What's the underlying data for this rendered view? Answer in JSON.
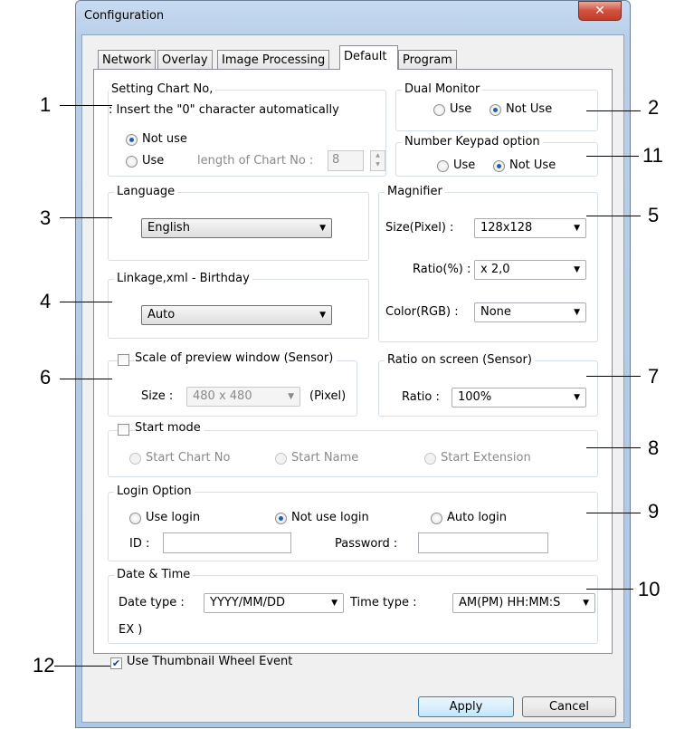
{
  "window": {
    "title": "Configuration",
    "close_label": "x"
  },
  "tabs": [
    "Network",
    "Overlay",
    "Image Processing",
    "Default",
    "Program"
  ],
  "chart_no": {
    "legend": "Setting Chart No,",
    "desc": ": Insert the \"0\" character automatically",
    "opt_not_use": "Not use",
    "opt_use": "Use",
    "length_label": "length of Chart No :",
    "length_value": "8"
  },
  "dual_monitor": {
    "legend": "Dual Monitor",
    "opt_use": "Use",
    "opt_not_use": "Not Use"
  },
  "keypad": {
    "legend": "Number Keypad option",
    "opt_use": "Use",
    "opt_not_use": "Not Use"
  },
  "language": {
    "legend": "Language",
    "value": "English"
  },
  "magnifier": {
    "legend": "Magnifier",
    "size_label": "Size(Pixel) :",
    "size_value": "128x128",
    "ratio_label": "Ratio(%) :",
    "ratio_value": "x 2,0",
    "color_label": "Color(RGB) :",
    "color_value": "None"
  },
  "linkage": {
    "legend": "Linkage,xml - Birthday",
    "value": "Auto"
  },
  "scale": {
    "legend": "Scale of preview window (Sensor)",
    "size_label": "Size :",
    "size_value": "480 x 480",
    "unit": "(Pixel)"
  },
  "ratio_screen": {
    "legend": "Ratio on screen (Sensor)",
    "ratio_label": "Ratio :",
    "ratio_value": "100%"
  },
  "start_mode": {
    "legend": "Start mode",
    "opt1": "Start Chart No",
    "opt2": "Start Name",
    "opt3": "Start Extension"
  },
  "login": {
    "legend": "Login Option",
    "opt1": "Use login",
    "opt2": "Not use login",
    "opt3": "Auto login",
    "id_label": "ID :",
    "pw_label": "Password :"
  },
  "datetime": {
    "legend": "Date & Time",
    "date_label": "Date type :",
    "date_value": "YYYY/MM/DD",
    "time_label": "Time type :",
    "time_value": "AM(PM) HH:MM:S",
    "ex_label": "EX )"
  },
  "thumb_wheel": {
    "label": "Use Thumbnail Wheel Event",
    "checked": true
  },
  "buttons": {
    "apply": "Apply",
    "cancel": "Cancel"
  },
  "callouts": [
    "1",
    "2",
    "11",
    "3",
    "5",
    "4",
    "6",
    "7",
    "8",
    "9",
    "10",
    "12"
  ],
  "icons": {
    "dropdown": "chevron-down-icon",
    "check": "check-icon",
    "close": "close-icon"
  }
}
